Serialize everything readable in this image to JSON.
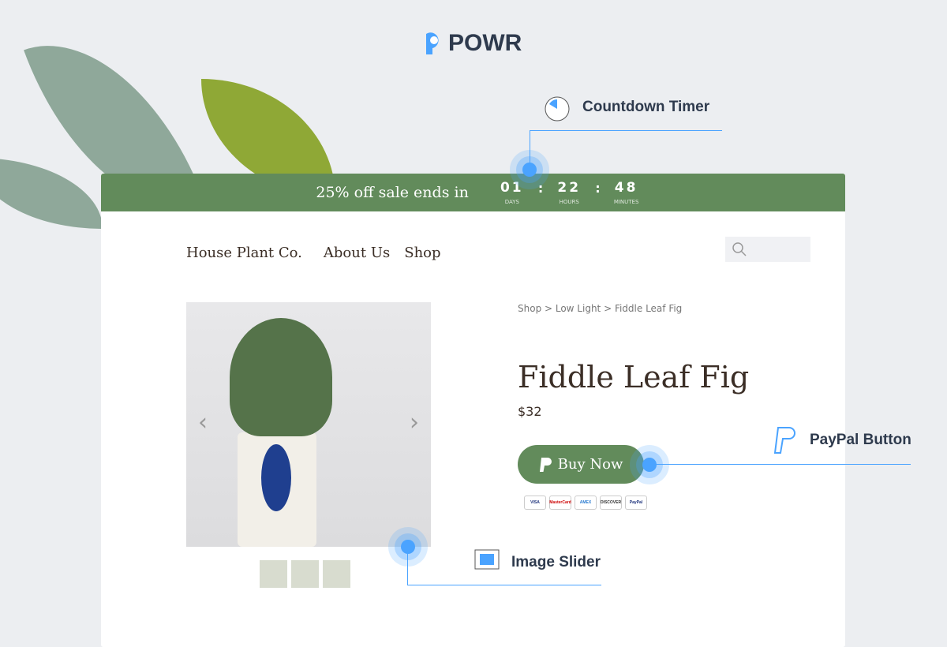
{
  "logo": "POWR",
  "callouts": {
    "countdown": "Countdown Timer",
    "paypal": "PayPal Button",
    "slider": "Image Slider"
  },
  "timer": {
    "message": "25% off sale ends in",
    "days": "01",
    "hours": "22",
    "minutes": "48",
    "days_label": "DAYS",
    "hours_label": "HOURS",
    "minutes_label": "MINUTES"
  },
  "nav": {
    "brand": "House Plant Co.",
    "about": "About Us",
    "shop": "Shop"
  },
  "breadcrumb": "Shop > Low Light > Fiddle Leaf Fig",
  "product": {
    "title": "Fiddle Leaf Fig",
    "price": "$32",
    "buy_label": "Buy Now"
  },
  "payment_methods": [
    "VISA",
    "MasterCard",
    "AMEX",
    "DISCOVER",
    "PayPal"
  ],
  "colors": {
    "accent": "#628b5b",
    "callout": "#4aa3ff"
  }
}
